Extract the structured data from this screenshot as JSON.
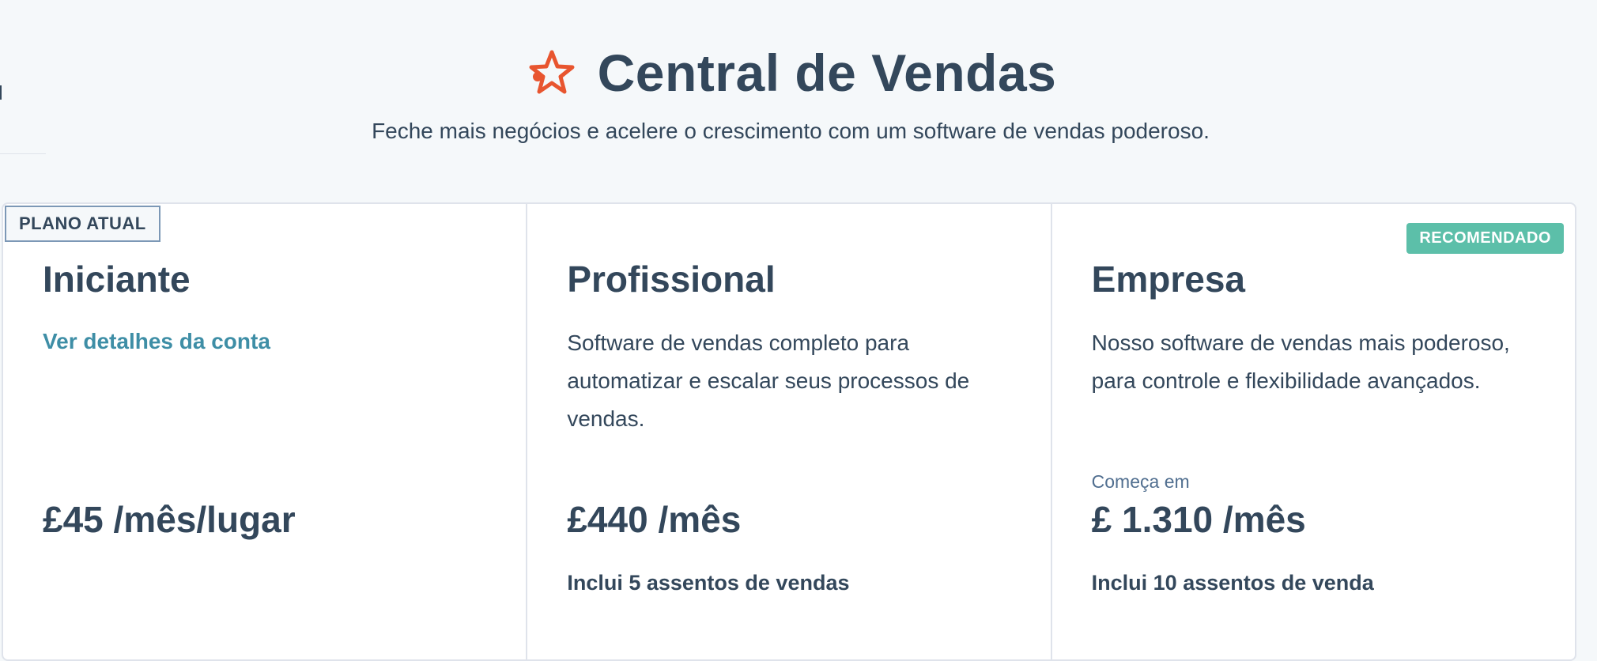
{
  "header": {
    "title": "Central de Vendas",
    "subtitle": "Feche mais negócios e acelere o crescimento com um software de vendas poderoso.",
    "icon": "hub-star-icon",
    "icon_color": "#e8552f"
  },
  "plans": [
    {
      "badge": "PLANO ATUAL",
      "name": "Iniciante",
      "link": "Ver detalhes da conta",
      "price": "£45 /mês/lugar"
    },
    {
      "name": "Profissional",
      "description": "Software de vendas completo para automatizar e escalar seus processos de vendas.",
      "price": "£440 /mês",
      "seats": "Inclui 5 assentos de vendas"
    },
    {
      "badge": "RECOMENDADO",
      "name": "Empresa",
      "description": "Nosso software de vendas mais poderoso, para controle e flexibilidade avançados.",
      "starts_at": "Começa em",
      "price": "£ 1.310 /mês",
      "seats": "Inclui 10 assentos de venda"
    }
  ],
  "colors": {
    "text": "#33475b",
    "link": "#3e8ea6",
    "recommended_badge": "#5cbfa9",
    "background": "#f5f8fa",
    "border": "#dfe3eb"
  }
}
